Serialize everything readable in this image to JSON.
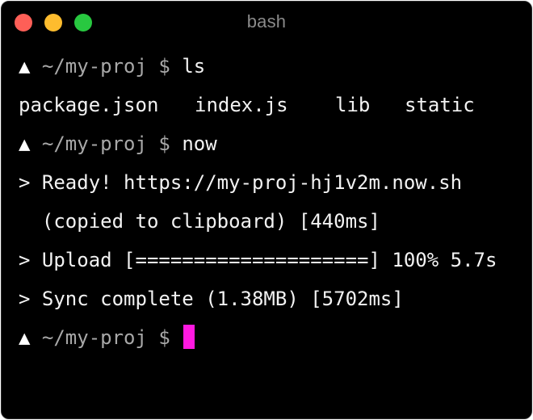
{
  "window": {
    "title": "bash"
  },
  "terminal": {
    "prompt_symbol": "▲",
    "prompt_path": "~/my-proj",
    "prompt_dollar": "$",
    "cmd1": "ls",
    "files": [
      "package.json",
      "index.js",
      "lib",
      "static"
    ],
    "cmd2": "now",
    "ready_line": "> Ready! https://my-proj-hj1v2m.now.sh",
    "copied_line": "  (copied to clipboard) [440ms]",
    "upload_line": "> Upload [====================] 100% 5.7s",
    "sync_line": "> Sync complete (1.38MB) [5702ms]",
    "cursor_color": "#ff19e0"
  }
}
